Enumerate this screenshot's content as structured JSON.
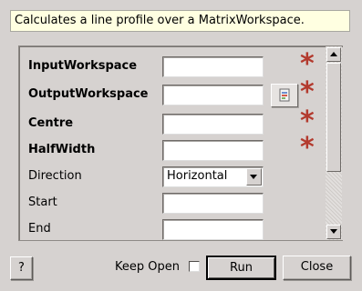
{
  "description": "Calculates a line profile over a MatrixWorkspace.",
  "properties": [
    {
      "label": "InputWorkspace",
      "required": true,
      "value": ""
    },
    {
      "label": "OutputWorkspace",
      "required": true,
      "value": ""
    },
    {
      "label": "Centre",
      "required": true,
      "value": ""
    },
    {
      "label": "HalfWidth",
      "required": true,
      "value": ""
    },
    {
      "label": "Direction",
      "required": false,
      "value": "Horizontal"
    },
    {
      "label": "Start",
      "required": false,
      "value": ""
    },
    {
      "label": "End",
      "required": false,
      "value": ""
    }
  ],
  "required_marker": "*",
  "icons": {
    "browse": "workspace-browse-icon",
    "required": "asterisk-icon"
  },
  "colors": {
    "required_marker": "#b33a2e",
    "description_bg": "#ffffe1"
  },
  "footer": {
    "help_label": "?",
    "keep_open_label": "Keep Open",
    "keep_open_checked": false,
    "run_label": "Run",
    "close_label": "Close"
  }
}
